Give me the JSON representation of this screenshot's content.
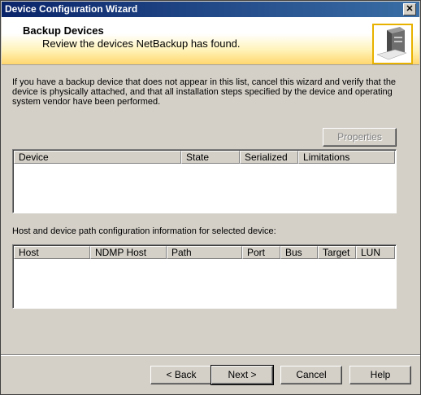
{
  "window": {
    "title": "Device Configuration Wizard",
    "close_glyph": "✕"
  },
  "header": {
    "title": "Backup Devices",
    "subtitle": "Review the devices NetBackup has found.",
    "icon": "server-computer-icon"
  },
  "description": "If you have a backup device that does not appear in this list, cancel this wizard and verify that the device is physically attached, and that all installation steps specified by the device and operating system vendor have been performed.",
  "properties_button": {
    "label": "Properties",
    "enabled": false
  },
  "devices_table": {
    "columns": [
      "Device",
      "State",
      "Serialized",
      "Limitations"
    ],
    "rows": []
  },
  "path_section": {
    "label": "Host and device path configuration information for selected device:",
    "columns": [
      "Host",
      "NDMP Host",
      "Path",
      "Port",
      "Bus",
      "Target",
      "LUN"
    ],
    "rows": []
  },
  "buttons": {
    "back": "< Back",
    "next": "Next >",
    "cancel": "Cancel",
    "help": "Help"
  }
}
